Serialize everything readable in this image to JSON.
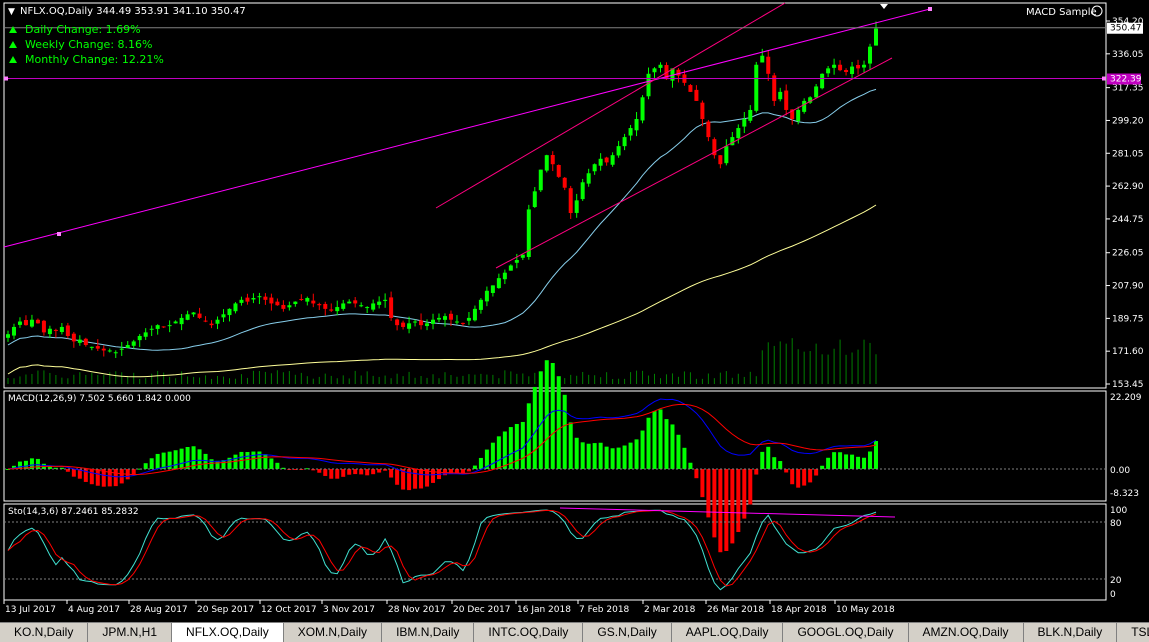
{
  "header": {
    "symbol_line": "NFLX.OQ,Daily  344.49 353.91 341.10 350.47",
    "expert": "MACD Sample"
  },
  "changes": [
    {
      "label": "Daily Change: 1.69%"
    },
    {
      "label": "Weekly Change: 8.16%"
    },
    {
      "label": "Monthly Change: 12.21%"
    }
  ],
  "colors": {
    "bull": "#00ff00",
    "bear": "#ff0000",
    "ma_fast": "#87ceeb",
    "ma_slow": "#ffff99",
    "channel": "#ff00ff",
    "volume": "#008000",
    "macd_line": "#0000ff",
    "signal_line": "#ff0000"
  },
  "chart_data": {
    "type": "candlestick",
    "price_axis_ticks": [
      "354.20",
      "336.05",
      "317.35",
      "299.20",
      "281.05",
      "262.90",
      "244.75",
      "226.05",
      "207.90",
      "189.75",
      "171.60",
      "153.45"
    ],
    "current_price_label": "350.47",
    "hline_label": "322.39",
    "hline_value": 322.39,
    "current_price": 350.47,
    "date_labels": [
      "13 Jul 2017",
      "4 Aug 2017",
      "28 Aug 2017",
      "20 Sep 2017",
      "12 Oct 2017",
      "3 Nov 2017",
      "28 Nov 2017",
      "20 Dec 2017",
      "16 Jan 2018",
      "7 Feb 2018",
      "2 Mar 2018",
      "26 Mar 2018",
      "18 Apr 2018",
      "10 May 2018"
    ],
    "closes": [
      181,
      185,
      188,
      186,
      189,
      187,
      182,
      184,
      183,
      185,
      180,
      177,
      178,
      175,
      174,
      173,
      172,
      172,
      171,
      173,
      175,
      177,
      180,
      182,
      184,
      186,
      185,
      186,
      188,
      190,
      192,
      193,
      190,
      188,
      186,
      189,
      192,
      195,
      198,
      200,
      199,
      201,
      202,
      200,
      198,
      197,
      195,
      197,
      199,
      200,
      201,
      198,
      197,
      195,
      194,
      196,
      198,
      199,
      198,
      197,
      196,
      198,
      199,
      200,
      190,
      186,
      185,
      187,
      188,
      186,
      187,
      189,
      190,
      191,
      189,
      188,
      187,
      190,
      195,
      200,
      205,
      208,
      212,
      215,
      219,
      222,
      225,
      250,
      260,
      272,
      280,
      275,
      268,
      262,
      248,
      255,
      265,
      270,
      275,
      278,
      276,
      280,
      285,
      290,
      295,
      300,
      312,
      325,
      328,
      330,
      322,
      328,
      324,
      320,
      315,
      310,
      300,
      290,
      280,
      275,
      285,
      290,
      295,
      300,
      305,
      330,
      335,
      325,
      310,
      315,
      305,
      300,
      305,
      310,
      312,
      318,
      325,
      328,
      330,
      327,
      326,
      329,
      328,
      330,
      340,
      350
    ],
    "macd": {
      "label": "MACD(12,26,9) 7.502 5.660 1.842 0.000",
      "axis_ticks": [
        "22.209",
        "0.00",
        "-8.323"
      ]
    },
    "stochastic": {
      "label": "Sto(14,3,6) 87.2461 85.2832",
      "axis_ticks": [
        "100",
        "80",
        "20",
        "0"
      ]
    }
  },
  "tabs": [
    {
      "label": "KO.N,Daily",
      "active": false
    },
    {
      "label": "JPM.N,H1",
      "active": false
    },
    {
      "label": "NFLX.OQ,Daily",
      "active": true
    },
    {
      "label": "XOM.N,Daily",
      "active": false
    },
    {
      "label": "IBM.N,Daily",
      "active": false
    },
    {
      "label": "INTC.OQ,Daily",
      "active": false
    },
    {
      "label": "GS.N,Daily",
      "active": false
    },
    {
      "label": "AAPL.OQ,Daily",
      "active": false
    },
    {
      "label": "GOOGL.OQ,Daily",
      "active": false
    },
    {
      "label": "AMZN.OQ,Daily",
      "active": false
    },
    {
      "label": "BLK.N,Daily",
      "active": false
    },
    {
      "label": "TSLA.OQ,Daily",
      "active": false
    }
  ]
}
